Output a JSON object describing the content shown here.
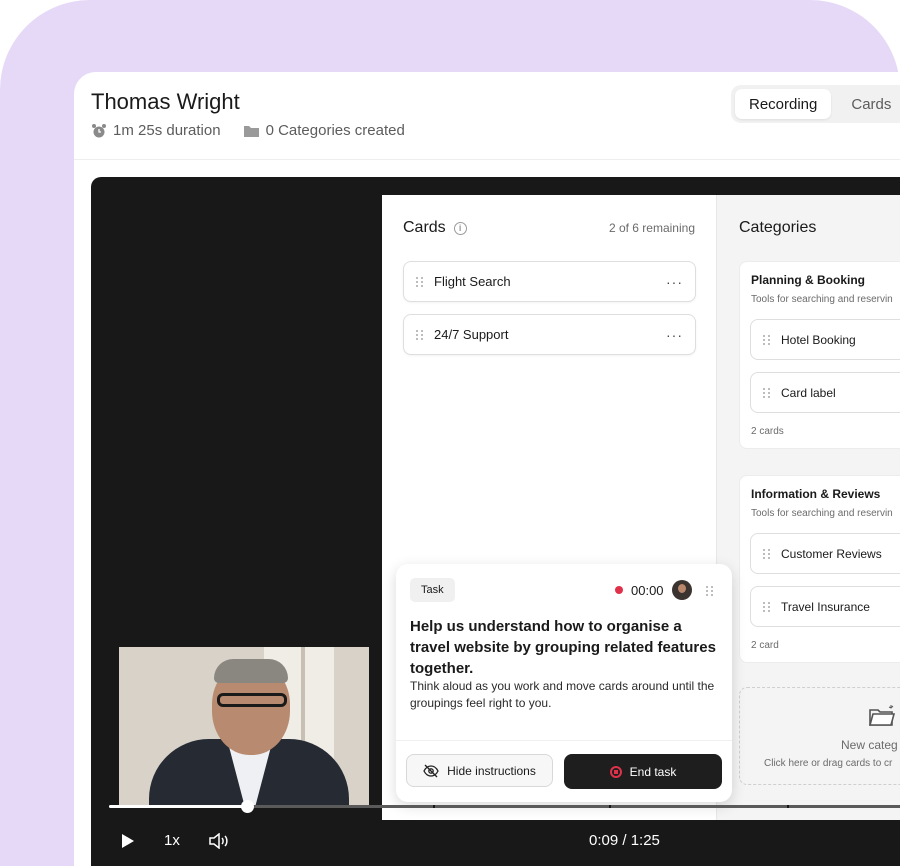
{
  "header": {
    "title": "Thomas Wright",
    "duration": "1m 25s duration",
    "categories_created": "0 Categories created"
  },
  "tabs": [
    {
      "label": "Recording",
      "active": true
    },
    {
      "label": "Cards",
      "active": false
    }
  ],
  "recording": {
    "cards_pane": {
      "title": "Cards",
      "remaining": "2 of 6 remaining",
      "cards": [
        {
          "label": "Flight Search"
        },
        {
          "label": "24/7 Support"
        }
      ]
    },
    "categories_pane": {
      "title": "Categories",
      "categories": [
        {
          "name": "Planning & Booking",
          "description": "Tools for searching and reservin",
          "cards": [
            "Hotel Booking",
            "Card label"
          ],
          "count": "2 cards"
        },
        {
          "name": "Information & Reviews",
          "description": "Tools for searching and reservin",
          "cards": [
            "Customer Reviews",
            "Travel Insurance"
          ],
          "count": "2 card"
        }
      ],
      "new_category": {
        "title": "New categ",
        "hint": "Click here or drag cards to cr"
      }
    },
    "task": {
      "chip": "Task",
      "timer": "00:00",
      "heading": "Help us understand how to organise a travel website by grouping related features together.",
      "body": "Think aloud as you work and move cards around until the groupings feel right to you.",
      "hide_label": "Hide instructions",
      "end_label": "End task"
    }
  },
  "player": {
    "speed": "1x",
    "time": "0:09 / 1:25",
    "progress": 0.166
  },
  "colors": {
    "background": "#e6d9f7",
    "record_red": "#e0314b",
    "player_bg": "#181818"
  }
}
